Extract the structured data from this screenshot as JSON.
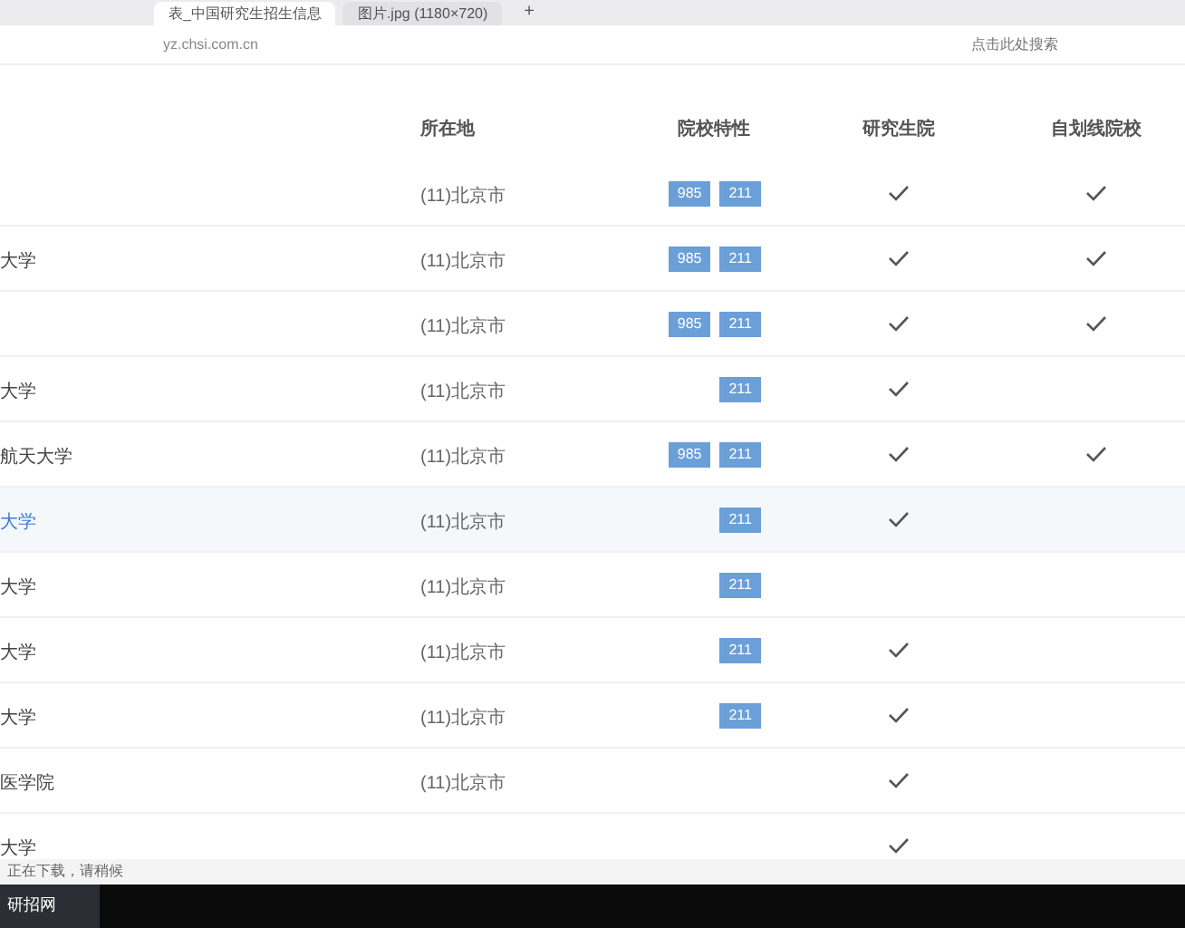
{
  "browser": {
    "tabs": [
      {
        "title": "表_中国研究生招生信息",
        "selected": true
      },
      {
        "title": "图片.jpg (1180×720)",
        "selected": false
      }
    ],
    "new_tab": "+",
    "url": "yz.chsi.com.cn",
    "search_placeholder": "点击此处搜索"
  },
  "table": {
    "columns": [
      "所在地",
      "院校特性",
      "研究生院",
      "自划线院校"
    ],
    "rows": [
      {
        "name": "",
        "location": "(11)北京市",
        "tags": [
          "985",
          "211"
        ],
        "graduate_school": true,
        "self_line": true,
        "highlighted": false
      },
      {
        "name": "大学",
        "location": "(11)北京市",
        "tags": [
          "985",
          "211"
        ],
        "graduate_school": true,
        "self_line": true,
        "highlighted": false
      },
      {
        "name": "",
        "location": "(11)北京市",
        "tags": [
          "985",
          "211"
        ],
        "graduate_school": true,
        "self_line": true,
        "highlighted": false
      },
      {
        "name": "大学",
        "location": "(11)北京市",
        "tags": [
          "211"
        ],
        "graduate_school": true,
        "self_line": false,
        "highlighted": false
      },
      {
        "name": "航天大学",
        "location": "(11)北京市",
        "tags": [
          "985",
          "211"
        ],
        "graduate_school": true,
        "self_line": true,
        "highlighted": false
      },
      {
        "name": "大学",
        "location": "(11)北京市",
        "tags": [
          "211"
        ],
        "graduate_school": true,
        "self_line": false,
        "highlighted": true
      },
      {
        "name": "大学",
        "location": "(11)北京市",
        "tags": [
          "211"
        ],
        "graduate_school": false,
        "self_line": false,
        "highlighted": false
      },
      {
        "name": "大学",
        "location": "(11)北京市",
        "tags": [
          "211"
        ],
        "graduate_school": true,
        "self_line": false,
        "highlighted": false
      },
      {
        "name": "大学",
        "location": "(11)北京市",
        "tags": [
          "211"
        ],
        "graduate_school": true,
        "self_line": false,
        "highlighted": false
      },
      {
        "name": "医学院",
        "location": "(11)北京市",
        "tags": [],
        "graduate_school": true,
        "self_line": false,
        "highlighted": false
      },
      {
        "name": "大学",
        "tags": [],
        "graduate_school": true,
        "self_line": false,
        "highlighted": false
      }
    ]
  },
  "status_bar": {
    "text": "正在下载，请稍候"
  },
  "taskbar": {
    "item": "研招网"
  }
}
